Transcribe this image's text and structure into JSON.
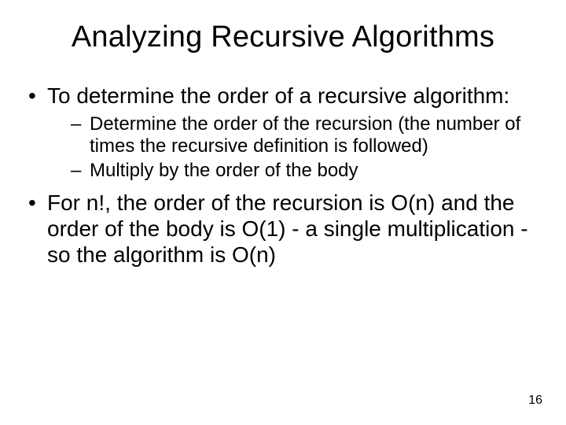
{
  "slide": {
    "title": "Analyzing Recursive Algorithms",
    "bullets": [
      {
        "text": "To determine the order of a recursive algorithm:",
        "sub": [
          "Determine the order of the recursion (the number of times the recursive definition is followed)",
          "Multiply by the order of the body"
        ]
      },
      {
        "text": "For n!, the order of the recursion is O(n) and the order of the body is O(1) - a single multiplication - so the algorithm is O(n)",
        "sub": []
      }
    ],
    "page_number": "16"
  }
}
